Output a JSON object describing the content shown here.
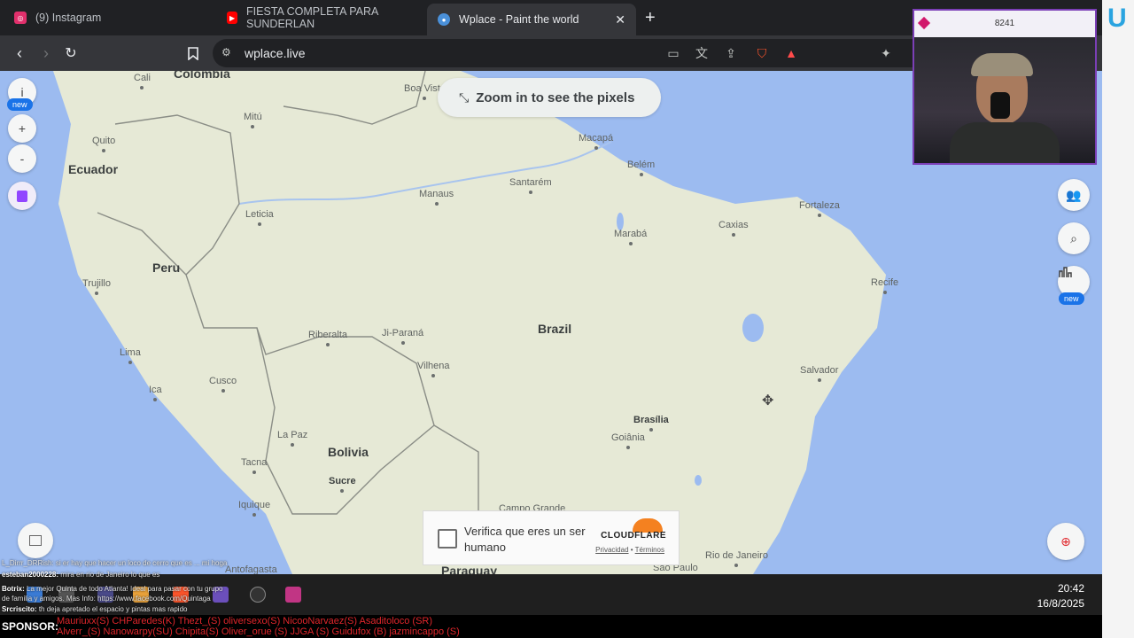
{
  "tabs": [
    {
      "title": "(9) Instagram",
      "icon": "instagram-icon",
      "color": "#e1306c"
    },
    {
      "title": "FIESTA COMPLETA PARA SUNDERLAN",
      "icon": "youtube-icon",
      "color": "#ff0000"
    },
    {
      "title": "Wplace - Paint the world",
      "icon": "globe-icon",
      "color": "#4a90d9"
    }
  ],
  "url": "wplace.live",
  "map": {
    "zoom_hint": "Zoom in to see the pixels",
    "new_badge": "new",
    "info_label": "i",
    "plus_label": "+",
    "minus_label": "-",
    "countries": [
      {
        "name": "Colombia"
      },
      {
        "name": "Ecuador"
      },
      {
        "name": "Peru"
      },
      {
        "name": "Brazil"
      },
      {
        "name": "Bolivia"
      },
      {
        "name": "Paraguay"
      }
    ],
    "cities": [
      "Cali",
      "Boa Vista",
      "Mitú",
      "Quito",
      "Macapá",
      "Belém",
      "Manaus",
      "Santarém",
      "Fortaleza",
      "Leticia",
      "Caxias",
      "Marabá",
      "Trujillo",
      "Recife",
      "Riberalta",
      "Ji-Paraná",
      "Lima",
      "Vilhena",
      "Salvador",
      "Cusco",
      "Ica",
      "Brasília",
      "Goiânia",
      "La Paz",
      "Tacna",
      "Sucre",
      "Iquique",
      "Campo Grande",
      "Antofagasta",
      "Rio de Janeiro",
      "São Paulo"
    ]
  },
  "captcha": {
    "text": "Verifica que eres un ser humano",
    "brand": "CLOUDFLARE",
    "privacy": "Privacidad",
    "separator": "•",
    "terms": "Términos"
  },
  "webcam": {
    "count": "8241"
  },
  "taskbar": {
    "time": "20:42",
    "date": "16/8/2025"
  },
  "chat": [
    {
      "user": "",
      "text": "L_Dirrr_DRRish: si er hay que hacer un loco de cerro que es ... mi hoga"
    },
    {
      "user": "esteban2000228:",
      "text": "mira en rio de Janeiro lo que es"
    },
    {
      "user": "Botrix:",
      "text": "La mejor Quinta de todo Atlanta! Ideal para pasar con tu grupo"
    },
    {
      "user": "",
      "text": "de familia y amigos. Mas Info: https://www.facebook.com/Quintaga"
    },
    {
      "user": "Srcriscito:",
      "text": "th deja apretado el espacio y pintas mas rapido"
    }
  ],
  "sponsor": {
    "label": "SPONSOR:",
    "line1": "Mauriuxx(S)  CHParedes(K) Thezt_(S) oliversexo(S) NicooNarvaez(S) Asaditoloco (SR)",
    "line2": "Alverr_(S) Nanowarpy(SU) Chipita(S) Oliver_orue (S) JJGA (S) Guidufox (B) jazmincappo (S)"
  },
  "colors": {
    "ocean": "#9cbbf0",
    "land": "#e6e9d6",
    "accent": "#1a73e8",
    "webcam_border": "#7b3fb6"
  }
}
